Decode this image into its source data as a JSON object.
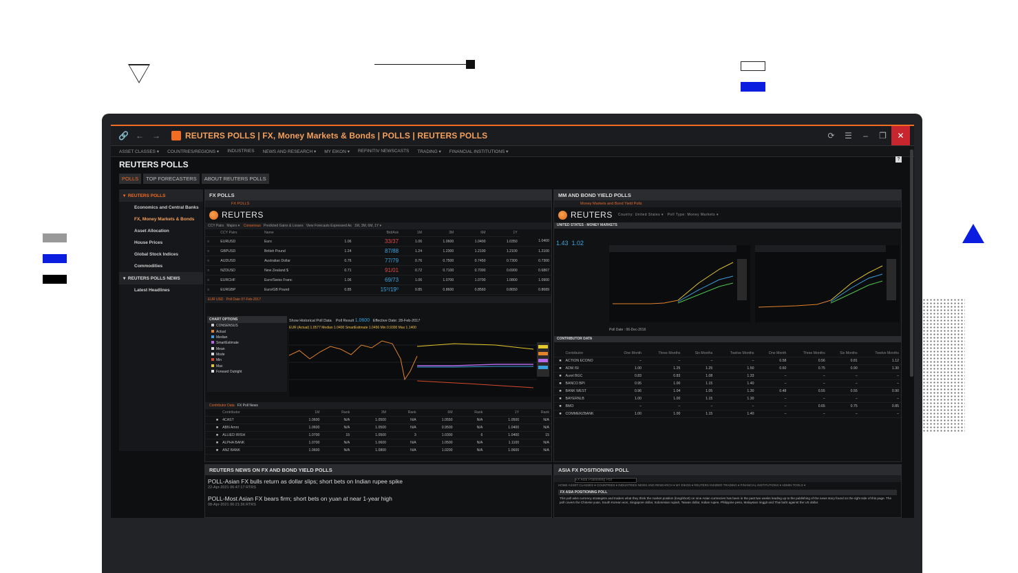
{
  "app": {
    "title": "REUTERS POLLS | FX, Money Markets & Bonds | POLLS | REUTERS POLLS"
  },
  "menu": [
    "ASSET CLASSES ▾",
    "COUNTRIES/REGIONS ▾",
    "INDUSTRIES",
    "NEWS AND RESEARCH ▾",
    "MY EIKON ▾",
    "REFINITIV NEWSCASTS",
    "TRADING ▾",
    "FINANCIAL INSTITUTIONS ▾"
  ],
  "page_title": "REUTERS POLLS",
  "tabs": [
    "POLLS",
    "TOP FORECASTERS",
    "ABOUT REUTERS POLLS"
  ],
  "sidebar": {
    "section1": "REUTERS POLLS",
    "items": [
      "Economics and Central Banks",
      "FX, Money Markets & Bonds",
      "Asset Allocation",
      "House Prices",
      "Global Stock Indices",
      "Commodities"
    ],
    "section2": "REUTERS POLLS NEWS",
    "items2": [
      "Latest Headlines"
    ]
  },
  "fx_polls": {
    "header": "FX POLLS",
    "logo": "REUTERS",
    "columns": [
      "CCY Pairs",
      "Name",
      "",
      "Bid/Ask",
      "1M",
      "3M",
      "6M",
      "1Y"
    ],
    "rows": [
      {
        "pair": "EURUSD",
        "name": "Euro",
        "prev": "1.06",
        "bidask": "33/37",
        "c": "red",
        "m1": "1.06",
        "m3": "1.0600",
        "m6": "1.0400",
        "y1": "1.0350",
        "y2": "1.0400"
      },
      {
        "pair": "GBPUSD",
        "name": "British Pound",
        "prev": "1.24",
        "bidask": "87/88",
        "c": "blue",
        "m1": "1.24",
        "m3": "1.2300",
        "m6": "1.2100",
        "y1": "1.2100",
        "y2": "1.2100"
      },
      {
        "pair": "AUDUSD",
        "name": "Australian Dollar",
        "prev": "0.76",
        "bidask": "77/79",
        "c": "blue",
        "m1": "0.76",
        "m3": "0.7500",
        "m6": "0.7450",
        "y1": "0.7300",
        "y2": "0.7300"
      },
      {
        "pair": "NZDUSD",
        "name": "New Zealand $",
        "prev": "0.71",
        "bidask": "91/01",
        "c": "red",
        "m1": "0.72",
        "m3": "0.7100",
        "m6": "0.7000",
        "y1": "0.6900",
        "y2": "0.6867"
      },
      {
        "pair": "EURCHF",
        "name": "Euro/Swiss Franc",
        "prev": "1.06",
        "bidask": "69/73",
        "c": "blue",
        "m1": "1.06",
        "m3": "1.0700",
        "m6": "1.0700",
        "y1": "1.0800",
        "y2": "1.0900"
      },
      {
        "pair": "EURGBP",
        "name": "Euro/GB Pound",
        "prev": "0.85",
        "bidask": "15⁰/19⁰",
        "c": "blue",
        "m1": "0.85",
        "m3": "0.8600",
        "m6": "0.8560",
        "y1": "0.8650",
        "y2": "0.8689"
      }
    ],
    "chart_options": [
      "CONSENSUS",
      "Actual",
      "Median",
      "SmartEstimate",
      "Mean",
      "Mode",
      "Min",
      "Max",
      "Forward Outright"
    ],
    "legend": "EUR (Actual) 1.0577  Median 1.0400  SmartEstimate 1.0456  Min 0.9300  Max 1.1400",
    "show_hist": "Show Historical Poll Data",
    "poll_result": "1.0600",
    "eff_date": "Effective Date: 28-Feb-2017",
    "contrib_cols": [
      "Contributor",
      "1M",
      "Rank",
      "3M",
      "Rank",
      "6M",
      "Rank",
      "1Y",
      "Rank"
    ],
    "contrib": [
      [
        "4CAST",
        "1.0600",
        "N/A",
        "1.0500",
        "N/A",
        "1.0550",
        "N/A",
        "1.0500",
        "N/A"
      ],
      [
        "ABN Amro",
        "1.0600",
        "N/A",
        "1.0500",
        "N/A",
        "0.9500",
        "N/A",
        "1.0400",
        "N/A"
      ],
      [
        "ALLIED IRISH",
        "1.0700",
        "15",
        "1.0500",
        "3",
        "1.0300",
        "6",
        "1.0400",
        "15"
      ],
      [
        "ALPHA BANK",
        "1.0700",
        "N/A",
        "1.0600",
        "N/A",
        "1.0500",
        "N/A",
        "1.1100",
        "N/A"
      ],
      [
        "ANZ BANK",
        "1.0600",
        "N/A",
        "1.0800",
        "N/A",
        "1.0200",
        "N/A",
        "1.0600",
        "N/A"
      ]
    ]
  },
  "mm_polls": {
    "header": "MM AND BOND YIELD POLLS",
    "logo": "REUTERS",
    "sub": "UNITED STATES - MONEY MARKETS",
    "v1": "1.43",
    "v2": "1.02",
    "poll_date": "Poll Date : 06-Dec-2016",
    "contrib_header": "CONTRIBUTOR DATA",
    "contrib_cols": [
      "Contributor",
      "One Month",
      "Three Months",
      "Six Months",
      "Twelve Months",
      "One Month",
      "Three Months",
      "Six Months",
      "Twelve Months"
    ],
    "contrib": [
      [
        "ACTION ECONO",
        "–",
        "–",
        "–",
        "–",
        "0.58",
        "0.56",
        "0.81",
        "1.12"
      ],
      [
        "ADM ISI",
        "1.00",
        "1.25",
        "1.25",
        "1.50",
        "0.60",
        "0.75",
        "0.90",
        "1.30"
      ],
      [
        "Aurel BGC",
        "0.83",
        "0.83",
        "1.08",
        "1.33",
        "–",
        "–",
        "–",
        "–"
      ],
      [
        "BANCO BPI",
        "0.95",
        "1.00",
        "1.15",
        "1.40",
        "–",
        "–",
        "–",
        "–"
      ],
      [
        "BANK WEST",
        "0.96",
        "1.04",
        "1.05",
        "1.30",
        "0.48",
        "0.55",
        "0.55",
        "0.90"
      ],
      [
        "BAYERNLB",
        "1.00",
        "1.00",
        "1.15",
        "1.30",
        "–",
        "–",
        "–",
        "–"
      ],
      [
        "BMO",
        "–",
        "–",
        "–",
        "–",
        "–",
        "0.65",
        "0.75",
        "0.85"
      ],
      [
        "COMMERZBANK",
        "1.00",
        "1.00",
        "1.15",
        "1.40",
        "–",
        "–",
        "–",
        "–"
      ]
    ]
  },
  "news": {
    "header": "REUTERS NEWS ON FX AND BOND YIELD POLLS",
    "items": [
      {
        "headline": "POLL-Asian FX bulls return as dollar slips; short bets on Indian rupee spike",
        "date": "22-Apr-2021 06:47:17 RTRS"
      },
      {
        "headline": "POLL-Most Asian FX bears firm; short bets on yuan at near 1-year high",
        "date": "08-Apr-2021 06:21:36 RTRS"
      }
    ]
  },
  "asia": {
    "header": "ASIA FX POSITIONING POLL",
    "search_placeholder": "FX Asia Positioning Poll",
    "title": "FX ASIA POSITIONING POLL",
    "text": "This poll asks currency strategists and traders what they think the market position (long/short) on nine Asian currencies has been in the past two weeks leading up to the publishing of the news story found on the right side of this page. The poll covers the Chinese yuan, South Korean won, Singapore dollar, Indonesian rupiah, Taiwan dollar, Indian rupee, Philippine peso, Malaysian ringgit and Thai baht against the US dollar."
  },
  "colors": {
    "accent": "#f26c21",
    "brand_blue": "#0b1ee0",
    "close": "#c8262e"
  }
}
